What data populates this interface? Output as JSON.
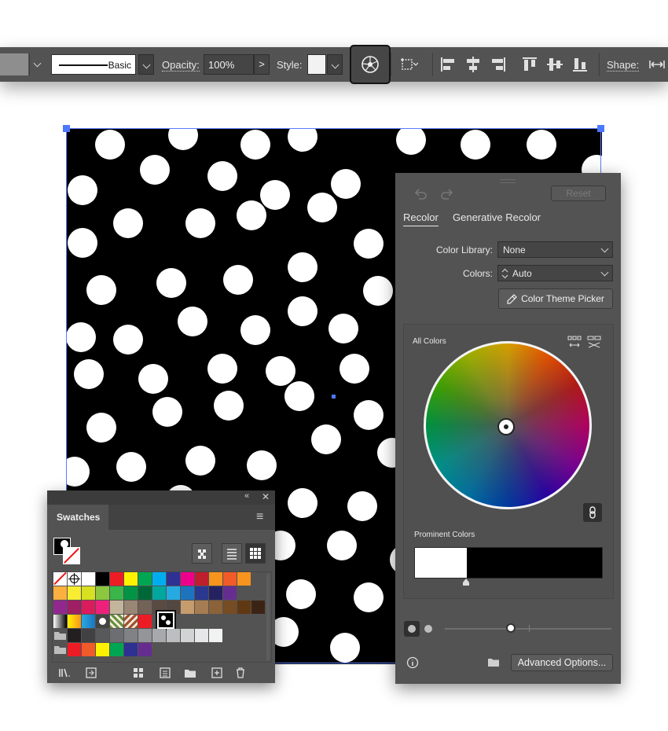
{
  "control_bar": {
    "stroke_profile_label": "Basic",
    "opacity_label": "Opacity:",
    "opacity_value": "100%",
    "opacity_arrow": ">",
    "style_label": "Style:",
    "shape_label": "Shape:"
  },
  "swatches_panel": {
    "tab_label": "Swatches",
    "collapse_glyph": "«",
    "close_glyph": "✕",
    "menu_glyph": "≡",
    "rows": [
      [
        "none",
        "reg",
        "#ffffff",
        "#000000",
        "#ed1c24",
        "#fff200",
        "#00a651",
        "#00aeef",
        "#2e3192",
        "#ec008c",
        "#be1e2d",
        "#f7941d",
        "#f15a29",
        "#f7941d"
      ],
      [
        "#fbb040",
        "#f9ed32",
        "#d7e021",
        "#8dc63f",
        "#39b54a",
        "#009444",
        "#006838",
        "#00a79d",
        "#27aae1",
        "#1c75bc",
        "#2b388f",
        "#262262",
        "#662d91"
      ],
      [
        "#92278f",
        "#9e1f63",
        "#da1c5c",
        "#ed217c",
        "#c2b59b",
        "#998675",
        "#736357",
        "#594a42",
        "#534741",
        "#c69c6d",
        "#a67c52",
        "#8c6239",
        "#754c24",
        "#603913",
        "#3c2415"
      ],
      [
        "grad-bw",
        "grad-or",
        "grad-bl",
        "pat-dots",
        "pat-1",
        "pat-2",
        "#ed1c24",
        "pat-sel"
      ],
      [
        "folder",
        "#231f20",
        "#414042",
        "#58595b",
        "#6d6e71",
        "#808285",
        "#939598",
        "#a7a9ac",
        "#bcbec0",
        "#d1d3d4",
        "#e6e7e8",
        "#f1f2f2"
      ],
      [
        "folder",
        "#ed1c24",
        "#f15a29",
        "#fff200",
        "#00a651",
        "#2e3192",
        "#662d91"
      ]
    ]
  },
  "recolor_panel": {
    "reset_label": "Reset",
    "tab_recolor": "Recolor",
    "tab_generative": "Generative Recolor",
    "color_library_label": "Color Library:",
    "color_library_value": "None",
    "colors_label": "Colors:",
    "colors_value": "Auto",
    "theme_picker_label": "Color Theme Picker",
    "all_colors_label": "All Colors",
    "prominent_colors_label": "Prominent Colors",
    "advanced_options_label": "Advanced Options...",
    "prominent_colors": [
      "#ffffff",
      "#000000"
    ]
  }
}
